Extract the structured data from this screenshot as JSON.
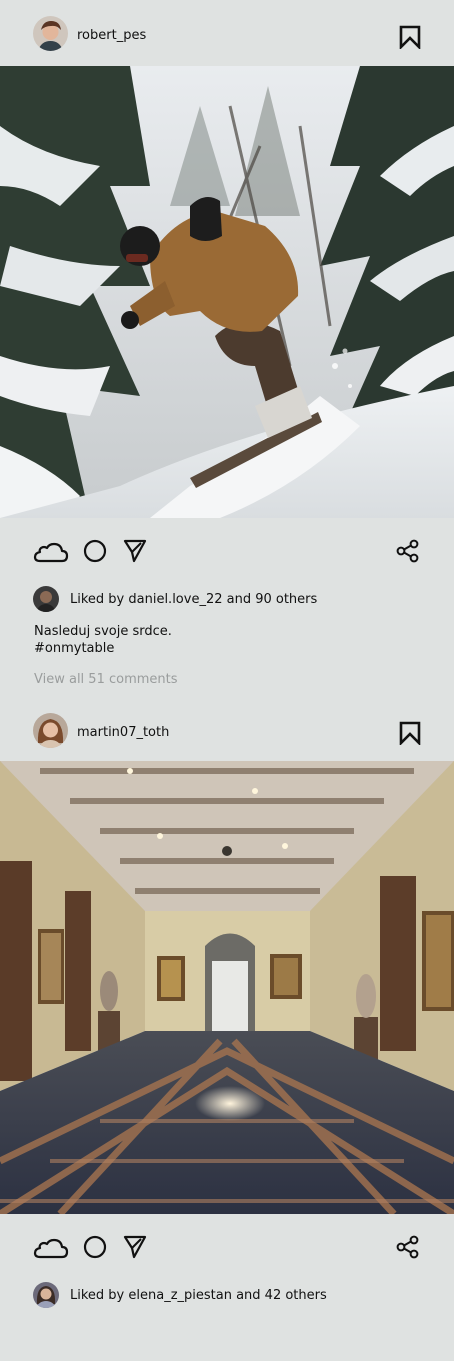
{
  "posts": [
    {
      "username": "robert_pes",
      "photo_alt": "Snowboarder in forest",
      "liked_by": "Liked by daniel.love_22 and 90 others",
      "caption_line1": "Nasleduj svoje srdce.",
      "caption_line2": "#onmytable",
      "view_comments": "View all 51 comments"
    },
    {
      "username": "martin07_toth",
      "photo_alt": "Museum hall",
      "liked_by": "Liked by elena_z_piestan and 42 others"
    }
  ],
  "icons": {
    "bookmark": "bookmark-icon",
    "like": "cloud-like-icon",
    "comment": "circle-comment-icon",
    "send": "send-icon",
    "share": "share-icon"
  },
  "colors": {
    "background": "#dfe2e1",
    "text": "#111111",
    "muted": "#9a9d9d"
  }
}
